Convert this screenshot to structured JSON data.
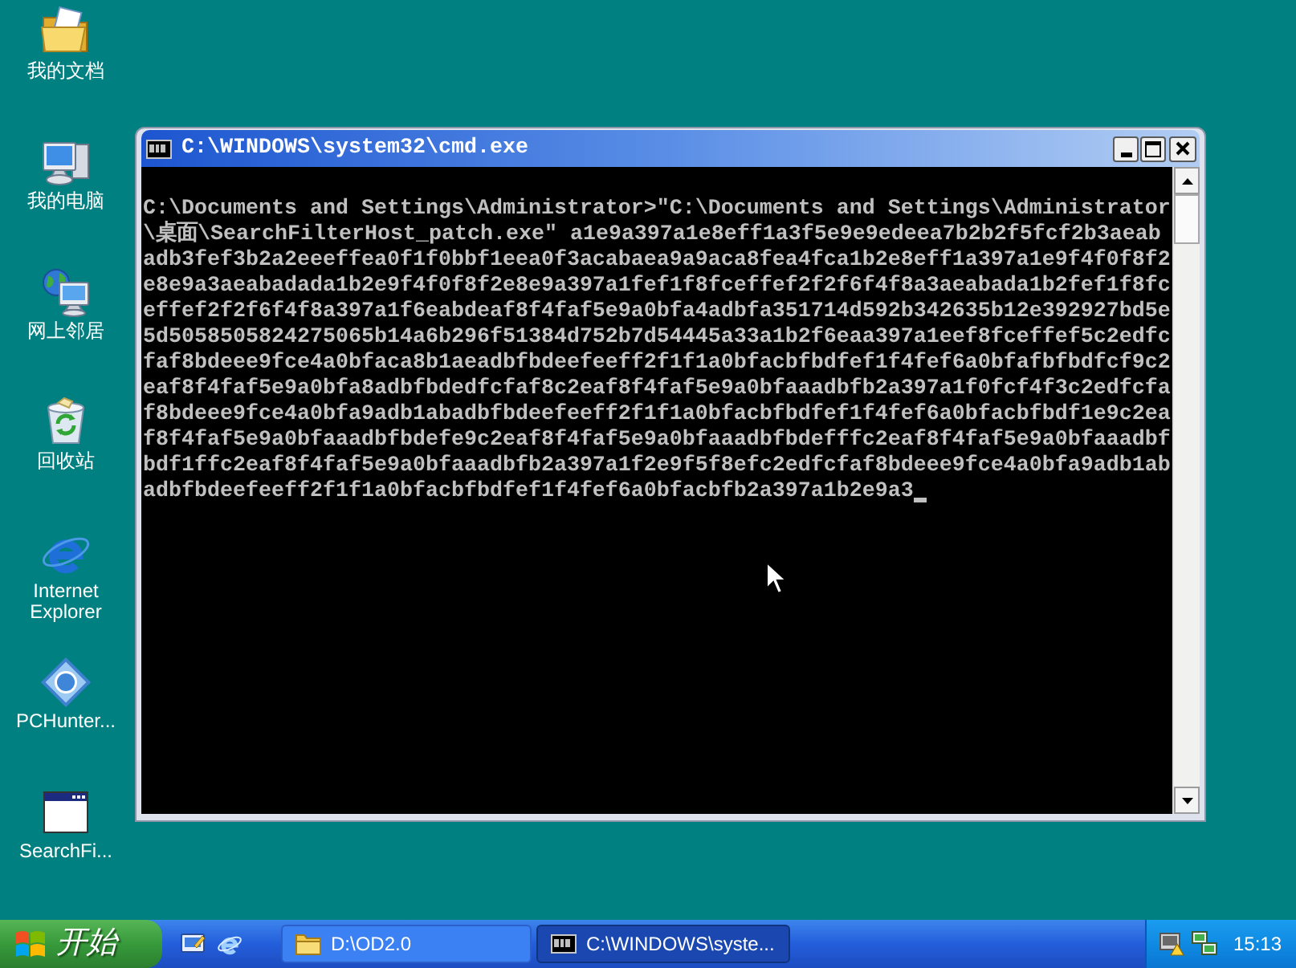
{
  "desktop": {
    "icons": [
      {
        "kind": "documents",
        "label": "我的文档"
      },
      {
        "kind": "computer",
        "label": "我的电脑"
      },
      {
        "kind": "network",
        "label": "网上邻居"
      },
      {
        "kind": "recycle_bin",
        "label": "回收站"
      },
      {
        "kind": "browser",
        "label": "Internet Explorer"
      },
      {
        "kind": "diamond_app",
        "label": "PCHunter..."
      },
      {
        "kind": "window_app",
        "label": "SearchFi..."
      }
    ]
  },
  "console_window": {
    "title": "C:\\WINDOWS\\system32\\cmd.exe",
    "lines": [
      "C:\\Documents and Settings\\Administrator>\"C:\\Documents and Settings\\Administrator",
      "\\桌面\\SearchFilterHost_patch.exe\" a1e9a397a1e8eff1a3f5e9e9edeea7b2b2f5fcf2b3aeab",
      "adb3fef3b2a2eeeffea0f1f0bbf1eea0f3acabaea9a9aca8fea4fca1b2e8eff1a397a1e9f4f0f8f2",
      "e8e9a3aeabadada1b2e9f4f0f8f2e8e9a397a1fef1f8fceffef2f2f6f4f8a3aeabada1b2fef1f8fc",
      "effef2f2f6f4f8a397a1f6eabdeaf8f4faf5e9a0bfa4adbfa351714d592b342635b12e392927bd5e",
      "5d5058505824275065b14a6b296f51384d752b7d54445a33a1b2f6eaa397a1eef8fceffef5c2edfc",
      "faf8bdeee9fce4a0bfaca8b1aeadbfbdeefeeff2f1f1a0bfacbfbdfef1f4fef6a0bfafbfbdfcf9c2",
      "eaf8f4faf5e9a0bfa8adbfbdedfcfaf8c2eaf8f4faf5e9a0bfaaadbfb2a397a1f0fcf4f3c2edfcfa",
      "f8bdeee9fce4a0bfa9adb1abadbfbdeefeeff2f1f1a0bfacbfbdfef1f4fef6a0bfacbfbdf1e9c2ea",
      "f8f4faf5e9a0bfaaadbfbdefe9c2eaf8f4faf5e9a0bfaaadbfbdefffc2eaf8f4faf5e9a0bfaaadbf",
      "bdf1ffc2eaf8f4faf5e9a0bfaaadbfb2a397a1f2e9f5f8efc2edfcfaf8bdeee9fce4a0bfa9adb1ab",
      "adbfbdeefeeff2f1f1a0bfacbfbdfef1f4fef6a0bfacbfb2a397a1b2e9a3"
    ]
  },
  "taskbar": {
    "start_label": "开始",
    "tasks": [
      {
        "kind": "folder",
        "label": "D:\\OD2.0",
        "selected": false
      },
      {
        "kind": "console",
        "label": "C:\\WINDOWS\\syste...",
        "selected": true
      }
    ],
    "clock": "15:13"
  }
}
